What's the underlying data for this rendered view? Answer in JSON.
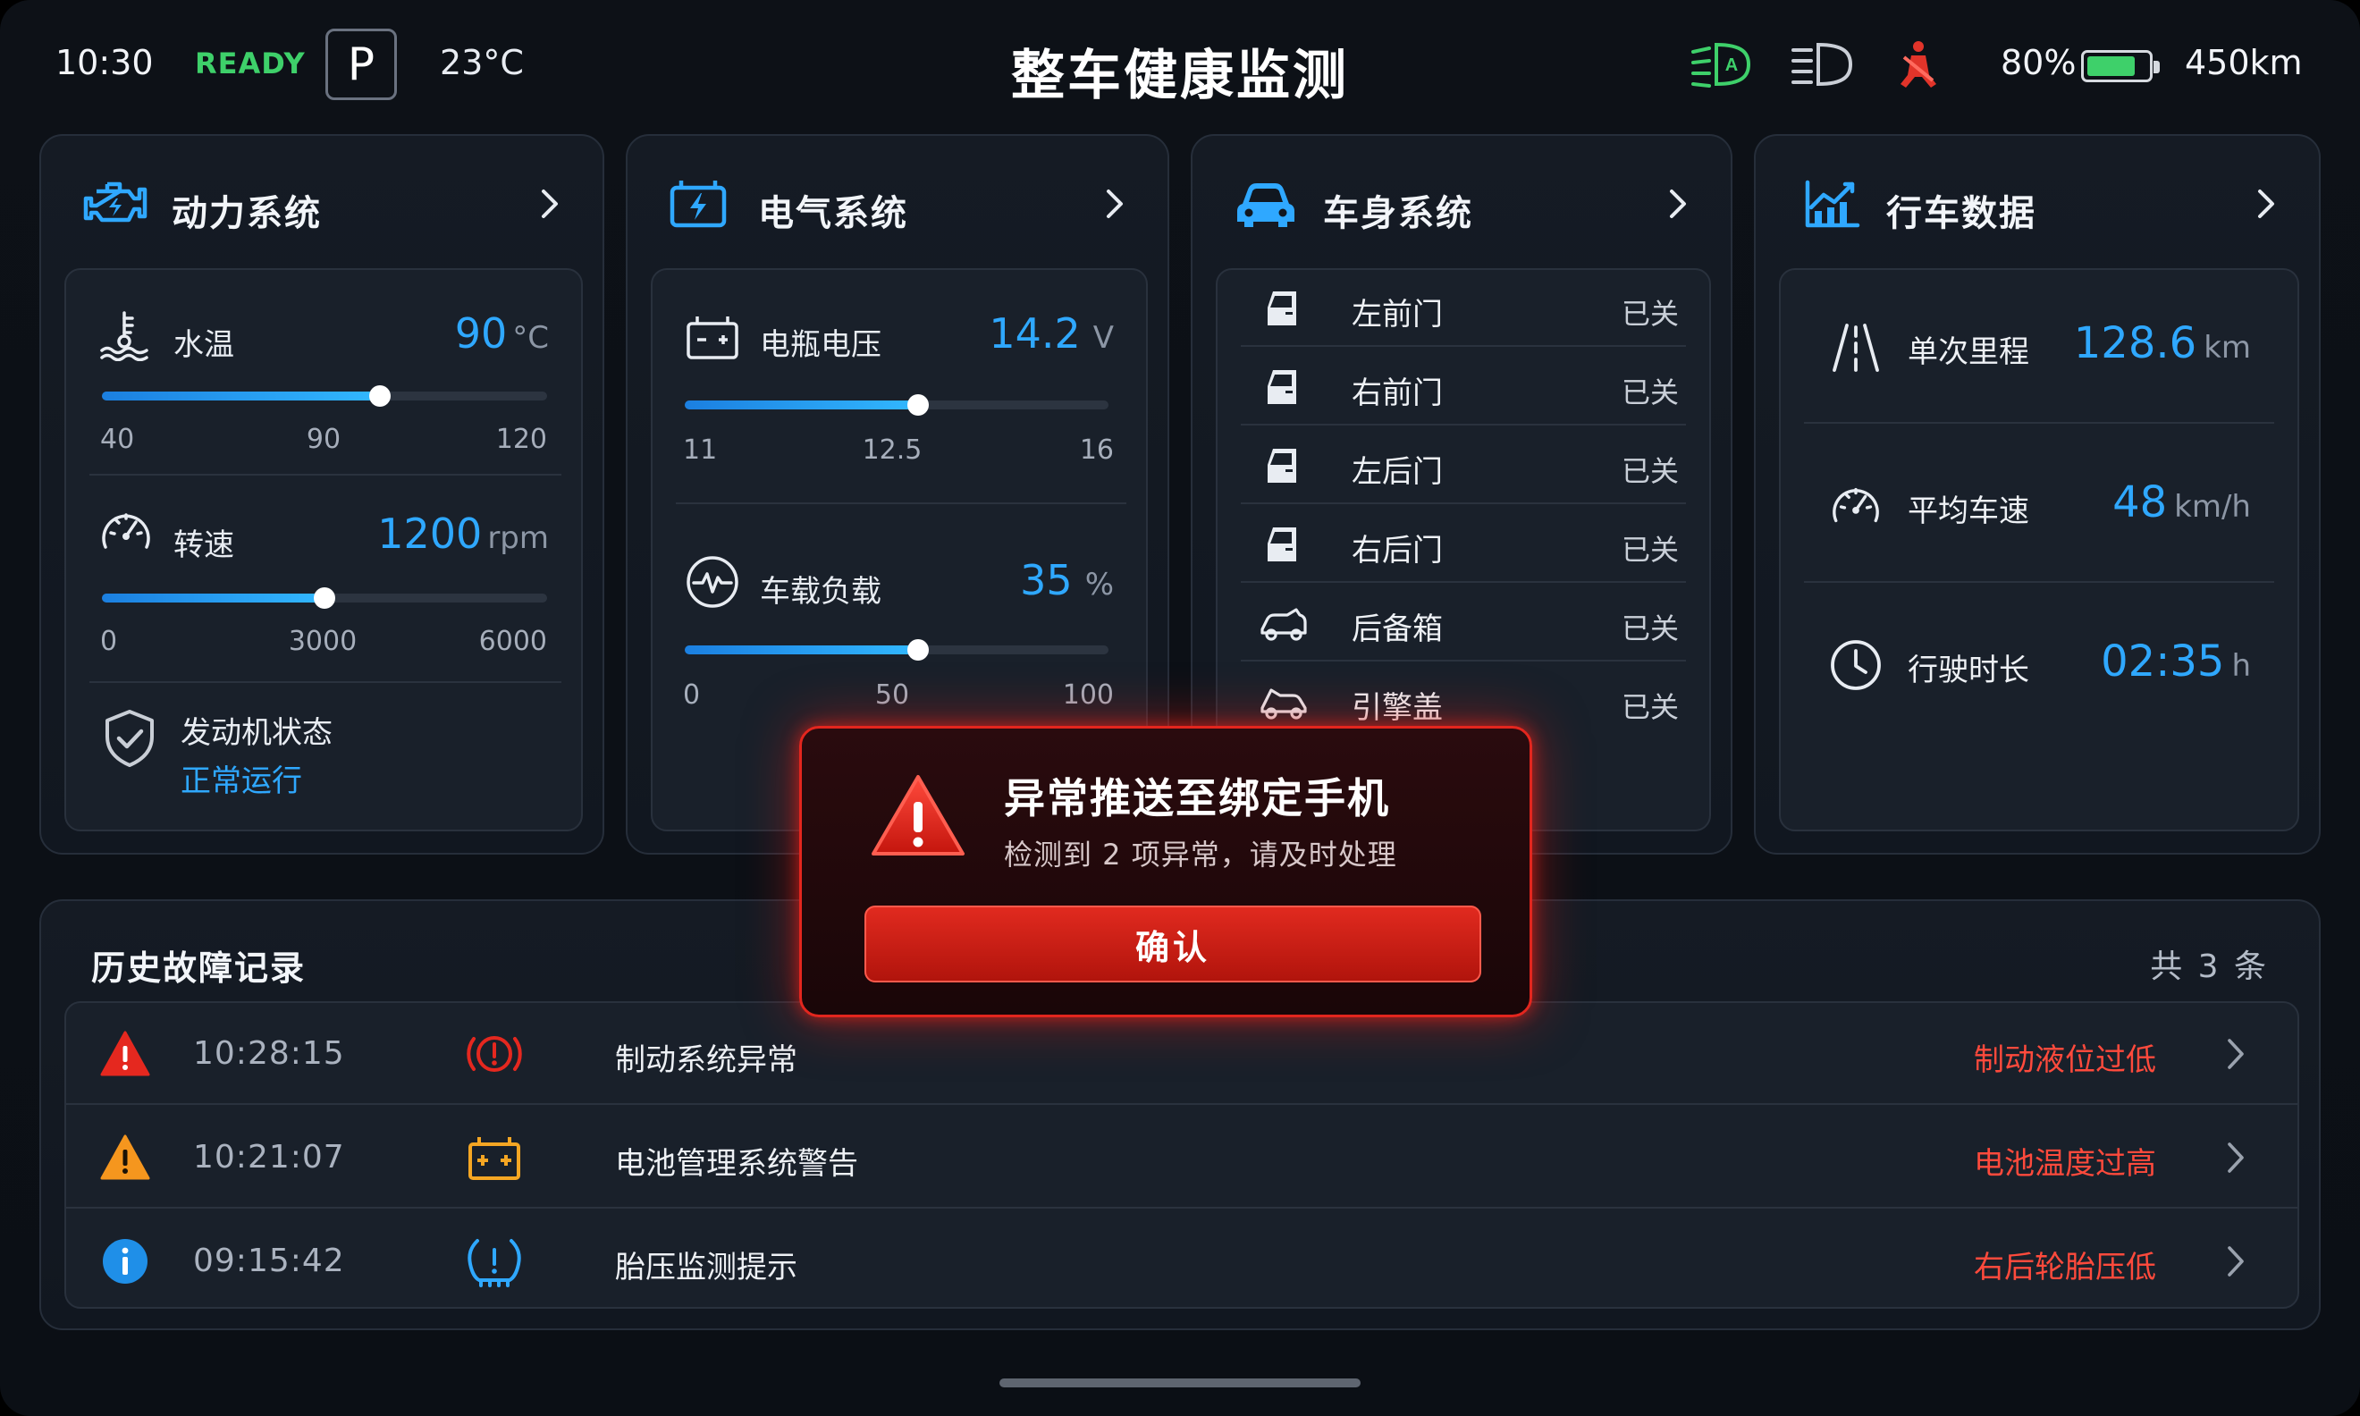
{
  "status_bar": {
    "time": "10:30",
    "ready": "READY",
    "gear": "P",
    "temperature": "23°C",
    "title": "整车健康监测",
    "icons": [
      "auto-headlight-icon",
      "low-beam-icon",
      "seatbelt-warning-icon"
    ],
    "battery_percent": "80%",
    "battery_level": 0.8,
    "range": "450km"
  },
  "power": {
    "title": "动力系统",
    "water_temp": {
      "label": "水温",
      "value": "90",
      "unit": "°C",
      "level": 0.625,
      "ticks": [
        "40",
        "90",
        "120"
      ]
    },
    "rpm": {
      "label": "转速",
      "value": "1200",
      "unit": "rpm",
      "level": 0.5,
      "ticks": [
        "0",
        "3000",
        "6000"
      ]
    },
    "engine": {
      "label": "发动机状态",
      "status": "正常运行"
    }
  },
  "electrical": {
    "title": "电气系统",
    "voltage": {
      "label": "电瓶电压",
      "value": "14.2",
      "unit": "V",
      "level": 0.55,
      "ticks": [
        "11",
        "12.5",
        "16"
      ]
    },
    "load": {
      "label": "车载负载",
      "value": "35",
      "unit": "%",
      "level": 0.55,
      "ticks": [
        "0",
        "50",
        "100"
      ]
    }
  },
  "body": {
    "title": "车身系统",
    "doors": [
      {
        "name": "左前门",
        "state": "已关"
      },
      {
        "name": "右前门",
        "state": "已关"
      },
      {
        "name": "左后门",
        "state": "已关"
      },
      {
        "name": "右后门",
        "state": "已关"
      },
      {
        "name": "后备箱",
        "state": "已关"
      },
      {
        "name": "引擎盖",
        "state": "已关"
      }
    ]
  },
  "trip": {
    "title": "行车数据",
    "items": [
      {
        "label": "单次里程",
        "value": "128.6",
        "unit": "km"
      },
      {
        "label": "平均车速",
        "value": "48",
        "unit": "km/h"
      },
      {
        "label": "行驶时长",
        "value": "02:35",
        "unit": "h"
      }
    ]
  },
  "history": {
    "title": "历史故障记录",
    "count": "共 3 条",
    "rows": [
      {
        "time": "10:28:15",
        "name": "制动系统异常",
        "detail": "制动液位过低"
      },
      {
        "time": "10:21:07",
        "name": "电池管理系统警告",
        "detail": "电池温度过高"
      },
      {
        "time": "09:15:42",
        "name": "胎压监测提示",
        "detail": "右后轮胎压低"
      }
    ]
  },
  "modal": {
    "title": "异常推送至绑定手机",
    "subtitle": "检测到 2 项异常，请及时处理",
    "confirm": "确认"
  },
  "colors": {
    "accent_blue": "#2fa8ff",
    "ok_green": "#3ed06a",
    "alert_red": "#ff4a3c",
    "warning_orange": "#f5a623"
  }
}
